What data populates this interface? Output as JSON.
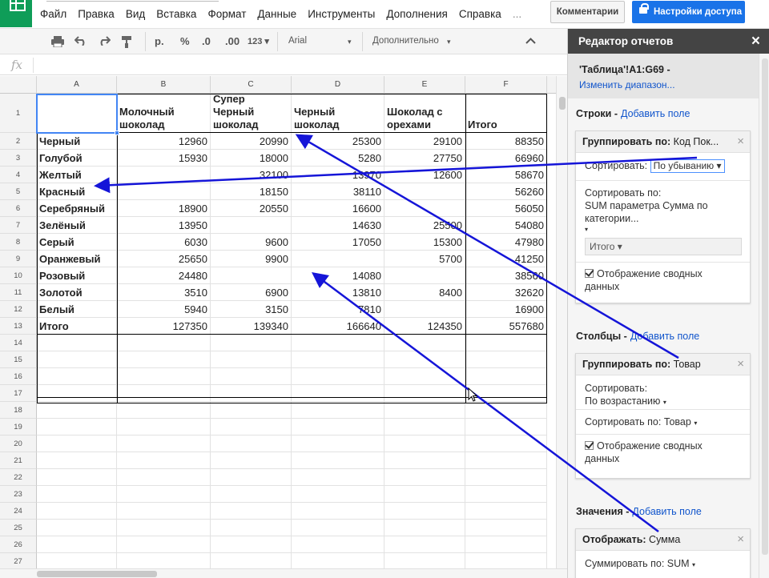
{
  "app": {
    "menus": [
      "Файл",
      "Правка",
      "Вид",
      "Вставка",
      "Формат",
      "Данные",
      "Инструменты",
      "Дополнения",
      "Справка",
      "..."
    ],
    "comments_label": "Комментарии",
    "share_label": "Настройки доступа",
    "colors": {
      "accent": "#1a73e8",
      "sheets_green": "#0f9d58",
      "annotation_arrow": "#1515d8",
      "link": "#1155cc"
    }
  },
  "toolbar": {
    "icons": [
      "print-icon",
      "undo-icon",
      "redo-icon",
      "paint-format-icon"
    ],
    "currency": "р.",
    "percent": "%",
    "dec_less": ".0",
    "dec_more": ".00",
    "format_123": "123",
    "font": "Arial",
    "more": "Дополнительно"
  },
  "formula_bar": {
    "fx": "fx"
  },
  "sheet": {
    "col_headers": [
      "A",
      "B",
      "C",
      "D",
      "E",
      "F"
    ],
    "row_numbers": [
      "1",
      "2",
      "3",
      "4",
      "5",
      "6",
      "7",
      "8",
      "9",
      "10",
      "11",
      "12",
      "13",
      "14",
      "15",
      "16",
      "17",
      "18",
      "19",
      "20",
      "21",
      "22",
      "23",
      "24",
      "25",
      "26",
      "27"
    ],
    "header_cells": [
      "",
      "Молочный шоколад",
      "Супер Черный шоколад",
      "Черный шоколад",
      "Шоколад с орехами",
      "Итого"
    ],
    "rows": [
      [
        "Черный",
        "12960",
        "20990",
        "25300",
        "29100",
        "88350"
      ],
      [
        "Голубой",
        "15930",
        "18000",
        "5280",
        "27750",
        "66960"
      ],
      [
        "Желтый",
        "",
        "32100",
        "13970",
        "12600",
        "58670"
      ],
      [
        "Красный",
        "",
        "18150",
        "38110",
        "",
        "56260"
      ],
      [
        "Серебряный",
        "18900",
        "20550",
        "16600",
        "",
        "56050"
      ],
      [
        "Зелёный",
        "13950",
        "",
        "14630",
        "25500",
        "54080"
      ],
      [
        "Серый",
        "6030",
        "9600",
        "17050",
        "15300",
        "47980"
      ],
      [
        "Оранжевый",
        "25650",
        "9900",
        "",
        "5700",
        "41250"
      ],
      [
        "Розовый",
        "24480",
        "",
        "14080",
        "",
        "38560"
      ],
      [
        "Золотой",
        "3510",
        "6900",
        "13810",
        "8400",
        "32620"
      ],
      [
        "Белый",
        "5940",
        "3150",
        "7810",
        "",
        "16900"
      ],
      [
        "Итого",
        "127350",
        "139340",
        "166640",
        "124350",
        "557680"
      ]
    ]
  },
  "panel": {
    "title": "Редактор отчетов",
    "close": "×",
    "range": "'Таблица'!A1:G69 -",
    "change_range": "Изменить диапазон...",
    "rows_label": "Строки -",
    "add_field": "Добавить поле",
    "row_group_label": "Группировать по:",
    "row_group_value": "Код Пок...",
    "sort_label": "Сортировать:",
    "sort_value": "По убыванию",
    "sort_by_line1": "Сортировать по:",
    "sort_by_line2": "SUM параметра Сумма по",
    "sort_by_line3": "категории...",
    "sort_by_select": "Итого",
    "show_totals_1": "Отображение сводных",
    "show_totals_2": "данных",
    "cols_label": "Столбцы -",
    "col_group_label": "Группировать по:",
    "col_group_value": "Товар",
    "col_sort_label": "Сортировать:",
    "col_sort_value": "По возрастанию",
    "col_sort_by": "Сортировать по: Товар",
    "values_label": "Значения -",
    "show_label": "Отображать:",
    "show_value": "Сумма",
    "summarize": "Суммировать по: SUM"
  }
}
